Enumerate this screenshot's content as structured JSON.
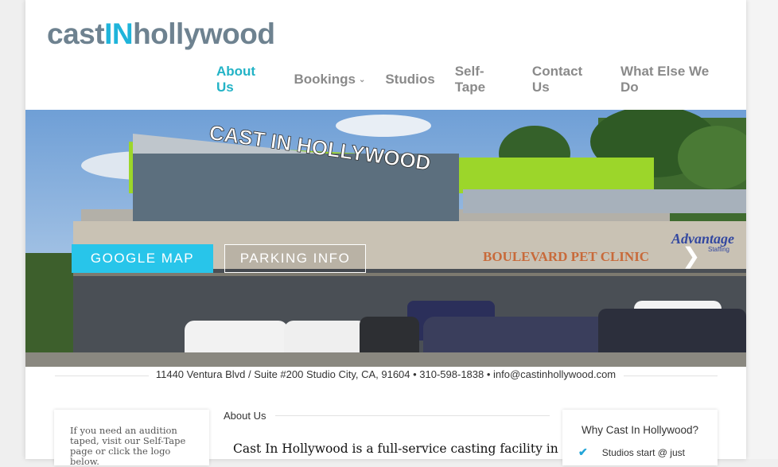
{
  "logo": {
    "part1": "cast",
    "part2": "IN",
    "part3": "hollywood"
  },
  "nav": [
    {
      "label": "About Us",
      "active": true
    },
    {
      "label": "Bookings",
      "has_dropdown": true
    },
    {
      "label": "Studios"
    },
    {
      "label": "Self-Tape"
    },
    {
      "label": "Contact Us"
    },
    {
      "label": "What Else We Do"
    }
  ],
  "hero": {
    "google_map_label": "GOOGLE MAP",
    "parking_info_label": "PARKING INFO",
    "prev_icon": "chevron-left-icon",
    "next_icon": "chevron-right-icon",
    "building_sign": "CAST IN HOLLYWOOD",
    "pet_clinic_sign": "BOULEVARD PET CLINIC",
    "advantage_sign": "Advantage",
    "advantage_sub": "Staffing",
    "colors": {
      "accent": "#28c5ea",
      "roof_green": "#9cd62a"
    }
  },
  "address_line": "11440 Ventura Blvd / Suite #200 Studio City, CA, 91604 • 310-598-1838 • info@castinhollywood.com",
  "left_sidebar": {
    "text": "If you need an audition taped, visit our Self-Tape page or click the logo below."
  },
  "main": {
    "heading": "About Us",
    "intro": "Cast In Hollywood is a full-service casting facility in"
  },
  "right_sidebar": {
    "title": "Why Cast In Hollywood?",
    "items": [
      {
        "text": "Studios start @ just",
        "icon": "check-icon"
      }
    ]
  }
}
